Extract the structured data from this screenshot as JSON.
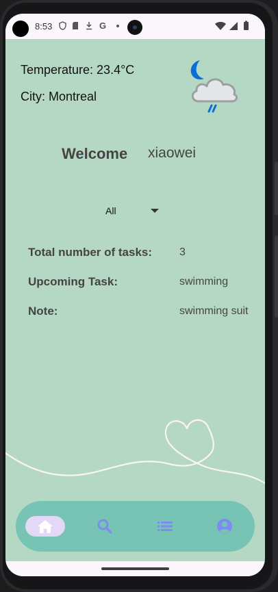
{
  "status_bar": {
    "time": "8:53",
    "left_icons": [
      "shield-icon",
      "sd-card-icon",
      "download-icon",
      "google-icon",
      "dot-icon"
    ],
    "right_icons": [
      "wifi-icon",
      "signal-icon",
      "battery-icon"
    ]
  },
  "weather": {
    "temperature_label": "Temperature: 23.4°C",
    "city_label": "City: Montreal",
    "icon": "night-rain-cloud-icon",
    "colors": {
      "moon": "#0a6fd6",
      "cloud_fill": "#e4e6e8",
      "cloud_stroke": "#9a9fa3",
      "rain": "#0a6fd6"
    }
  },
  "welcome": {
    "label": "Welcome",
    "username": "xiaowei"
  },
  "filter": {
    "selected": "All"
  },
  "summary": {
    "total_tasks_label": "Total number of tasks:",
    "total_tasks_value": "3",
    "upcoming_label": "Upcoming Task:",
    "upcoming_value": "swimming",
    "note_label": "Note:",
    "note_value": "swimming suit"
  },
  "nav": {
    "items": [
      {
        "icon": "home-icon",
        "active": true
      },
      {
        "icon": "search-icon",
        "active": false
      },
      {
        "icon": "list-icon",
        "active": false
      },
      {
        "icon": "account-icon",
        "active": false
      }
    ]
  },
  "colors": {
    "background": "#b5d8c4",
    "nav_bar": "#77c4b4",
    "nav_active_pill": "#e3d9f6",
    "nav_icon": "#7d8cf0",
    "decoration_line": "#fbf7e8"
  }
}
